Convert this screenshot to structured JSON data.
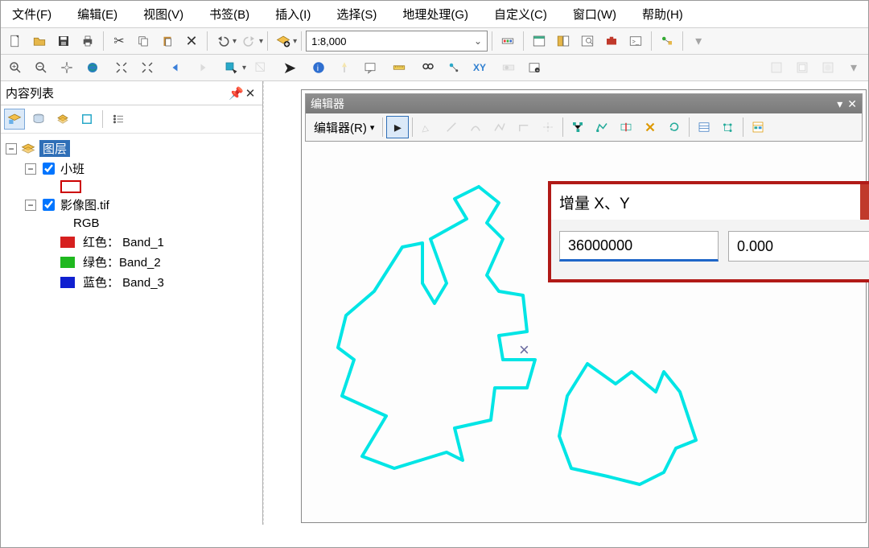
{
  "menu": {
    "file": "文件(F)",
    "edit": "编辑(E)",
    "view": "视图(V)",
    "bookmark": "书签(B)",
    "insert": "插入(I)",
    "select": "选择(S)",
    "geo": "地理处理(G)",
    "custom": "自定义(C)",
    "window": "窗口(W)",
    "help": "帮助(H)"
  },
  "toolbar": {
    "scale": "1:8,000"
  },
  "toc": {
    "title": "内容列表",
    "root_label": "图层",
    "layer_xiaoban": "小班",
    "layer_raster": "影像图.tif",
    "rgb_label": "RGB",
    "bands": [
      {
        "label": "红色：  Band_1",
        "color": "#d6201f"
      },
      {
        "label": "绿色：Band_2",
        "color": "#1fb81f"
      },
      {
        "label": "蓝色：  Band_3",
        "color": "#1020d0"
      }
    ]
  },
  "editor": {
    "title": "编辑器",
    "menu_label": "编辑器(R)"
  },
  "delta": {
    "title": "增量 X、Y",
    "x": "36000000",
    "y": "0.000"
  }
}
